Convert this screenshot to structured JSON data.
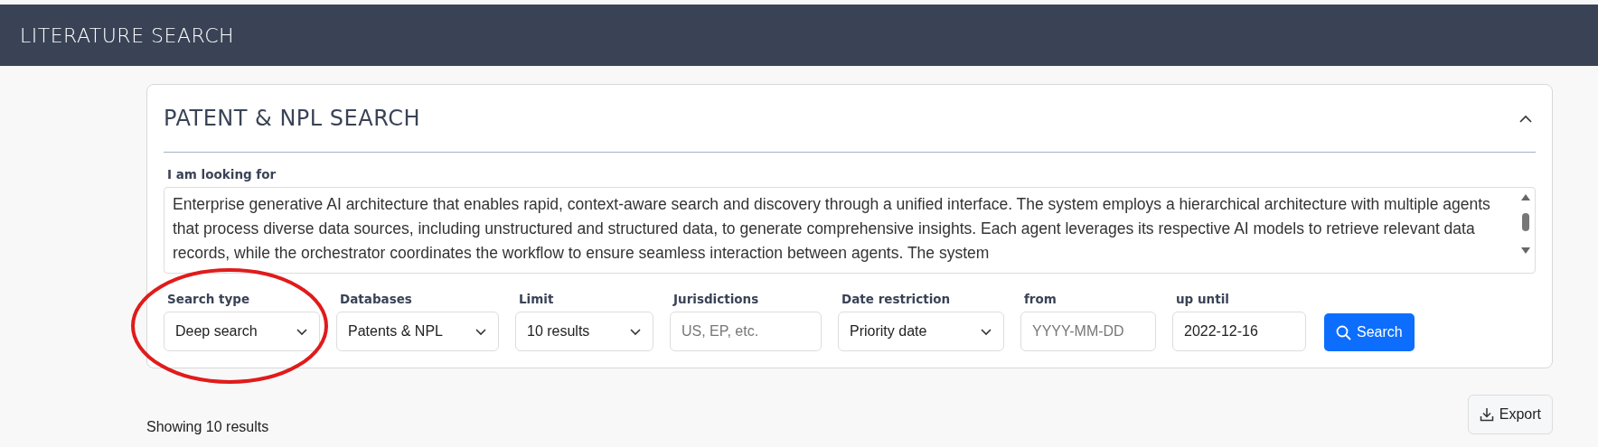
{
  "header": {
    "title": "LITERATURE SEARCH"
  },
  "panel": {
    "title": "PATENT & NPL SEARCH",
    "expanded": true,
    "query": {
      "label": "I am looking for",
      "value": "Enterprise generative AI architecture that enables rapid, context-aware search and discovery through a unified interface. The system employs a hierarchical architecture with multiple agents that process diverse data sources, including unstructured and structured data, to generate comprehensive insights. Each agent leverages its respective AI models to retrieve relevant data records, while the orchestrator coordinates the workflow to ensure seamless interaction between agents. The system"
    },
    "filters": [
      {
        "kind": "select",
        "label": "Search type",
        "value": "Deep search",
        "highlighted": true
      },
      {
        "kind": "select",
        "label": "Databases",
        "value": "Patents & NPL",
        "highlighted": false
      },
      {
        "kind": "select",
        "label": "Limit",
        "value": "10 results",
        "highlighted": false
      },
      {
        "kind": "input",
        "label": "Jurisdictions",
        "placeholder": "US, EP, etc.",
        "highlighted": false
      },
      {
        "kind": "select",
        "label": "Date restriction",
        "value": "Priority date",
        "highlighted": false
      },
      {
        "kind": "input",
        "label": "from",
        "placeholder": "YYYY-MM-DD",
        "highlighted": false
      },
      {
        "kind": "input",
        "label": "up until",
        "value": "2022-12-16",
        "highlighted": false
      }
    ],
    "search_button": "Search"
  },
  "results": {
    "summary": "Showing 10 results",
    "export_button": "Export"
  }
}
